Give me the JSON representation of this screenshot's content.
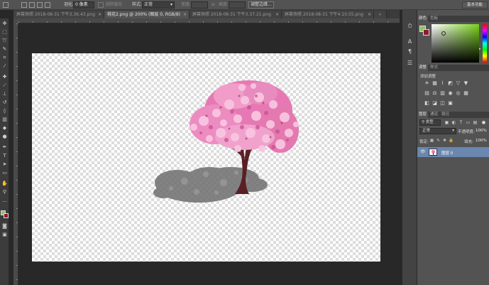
{
  "options_bar": {
    "feather_label": "羽化:",
    "feather_value": "0 像素",
    "antialias_label": "消除锯齿",
    "style_label": "样式:",
    "style_value": "正常",
    "width_label": "宽度:",
    "height_label": "高度:",
    "refine_edge_label": "调整边缘...",
    "workspace_label": "基本功能"
  },
  "tabs": [
    {
      "label": "屏幕快照 2018-08-31 下午3.36.43.png",
      "active": false
    },
    {
      "label": "桃花2.png @ 200% (图层 0, RGB/8)",
      "active": true
    },
    {
      "label": "屏幕快照 2018-08-31 下午3.37.21.png",
      "active": false
    },
    {
      "label": "屏幕快照 2018-08-31 下午4.10.55.png",
      "active": false
    }
  ],
  "color_panel": {
    "tabs": [
      "颜色",
      "色板"
    ],
    "foreground": "#8fbf6a",
    "background": "#8c1b2e",
    "picker_hue": "#7ad21c"
  },
  "adjustments_panel": {
    "tabs": [
      "调整",
      "样式"
    ],
    "title": "添加调整"
  },
  "layers_panel": {
    "tabs": [
      "图层",
      "通道",
      "路径"
    ],
    "filter_label": "类型",
    "blend_mode": "正常",
    "opacity_label": "不透明度:",
    "opacity_value": "100%",
    "lock_label": "锁定:",
    "fill_label": "填充:",
    "fill_value": "100%",
    "layers": [
      {
        "name": "图层 0",
        "visible": true,
        "selected": true
      }
    ]
  }
}
